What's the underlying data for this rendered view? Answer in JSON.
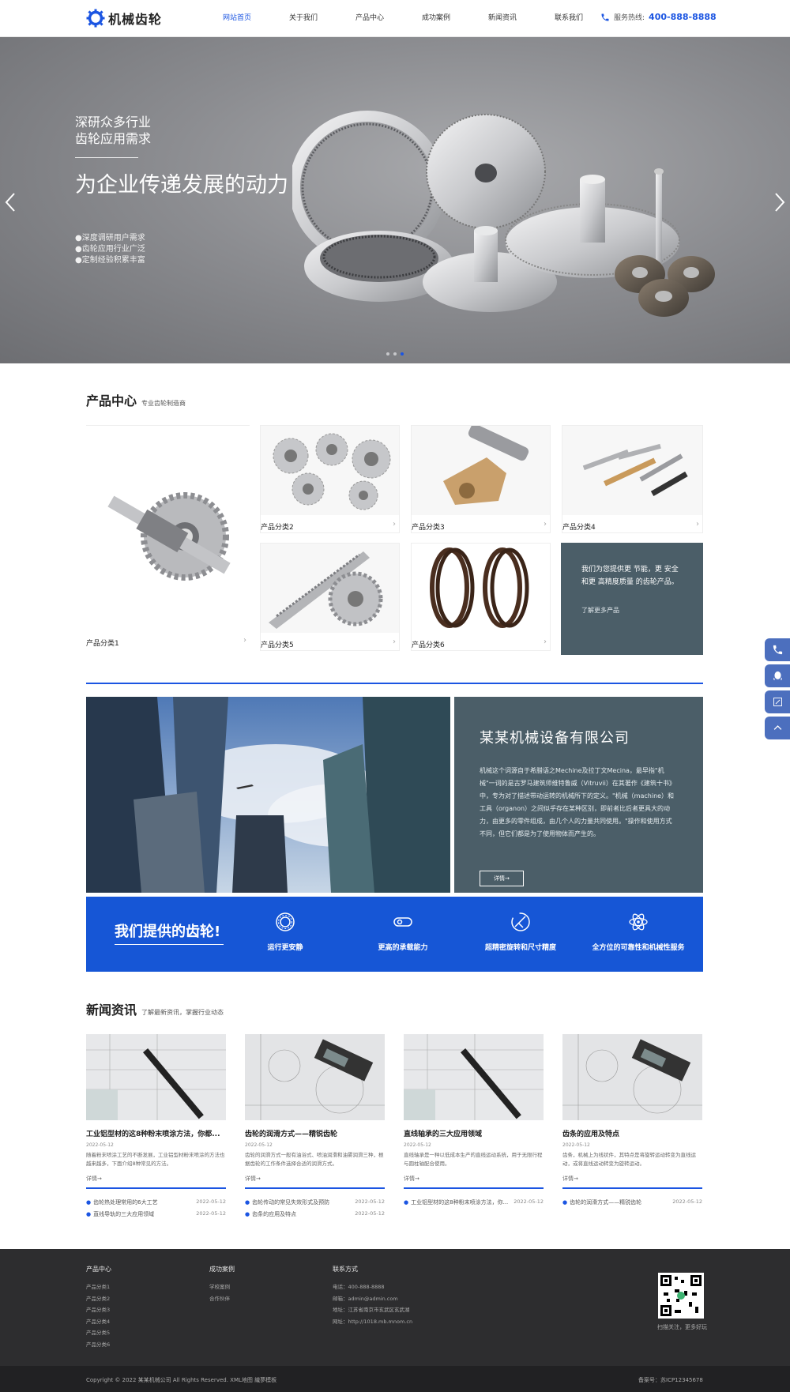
{
  "header": {
    "logo_text": "机械齿轮",
    "nav": [
      {
        "label": "网站首页",
        "active": true
      },
      {
        "label": "关于我们"
      },
      {
        "label": "产品中心"
      },
      {
        "label": "成功案例"
      },
      {
        "label": "新闻资讯"
      },
      {
        "label": "联系我们"
      }
    ],
    "hotline_label": "服务热线:",
    "hotline_number": "400-888-8888",
    "accent_color": "#1b55e2"
  },
  "banner": {
    "subtitle_line1": "深研众多行业",
    "subtitle_line2": "齿轮应用需求",
    "title": "为企业传递发展的动力",
    "bullets": [
      "●深度调研用户需求",
      "●齿轮应用行业广泛",
      "●定制经验积累丰富"
    ],
    "prev_icon": "chevron-left-icon",
    "next_icon": "chevron-right-icon"
  },
  "products": {
    "title": "产品中心",
    "subtitle": "专业齿轮制造商",
    "items": [
      {
        "label": "产品分类1"
      },
      {
        "label": "产品分类2"
      },
      {
        "label": "产品分类3"
      },
      {
        "label": "产品分类4"
      },
      {
        "label": "产品分类5"
      },
      {
        "label": "产品分类6"
      }
    ],
    "promo_text": "我们为您提供更 节能，更 安全和更 高精度质量 的齿轮产品。",
    "promo_link": "了解更多产品"
  },
  "about": {
    "title": "某某机械设备有限公司",
    "text": "机械这个词源自于希腊语之Mechine及拉丁文Mecina，最早指\"机械\"一词的是古罗马建筑师维特鲁威（Vitruvii）在其著作《建筑十书》中，专为对了描述带动运转的机械所下的定义。\"机械（machine）和工具（organon）之间似乎存在某种区别，即前者比后者更具大的动力，由更多的零件组成，由几个人的力量共同使用。\"操作和使用方式不同，但它们都是为了使用物体而产生的。",
    "button": "详情→"
  },
  "features": {
    "title": "我们提供的齿轮!",
    "items": [
      {
        "label": "运行更安静",
        "icon": "bearing-icon"
      },
      {
        "label": "更高的承载能力",
        "icon": "capsule-icon"
      },
      {
        "label": "超精密旋转和尺寸精度",
        "icon": "caliper-icon"
      },
      {
        "label": "全方位的可靠性和机械性服务",
        "icon": "atom-icon"
      }
    ]
  },
  "news": {
    "title": "新闻资讯",
    "subtitle": "了解最新资讯，掌握行业动态",
    "cards": [
      {
        "title": "工业铝型材的这8种粉末喷涂方法，你都...",
        "date": "2022-05-12",
        "summary": "随着粉末喷涂工艺的不断发展，工业铝型材粉末喷涂的方法也越来越多，下面介绍8种常见的方法。",
        "more": "详情→",
        "list": [
          {
            "title": "齿轮热处理常用的6大工艺",
            "date": "2022-05-12"
          },
          {
            "title": "直线导轨的三大应用领域",
            "date": "2022-05-12"
          }
        ]
      },
      {
        "title": "齿轮的润滑方式——精锐齿轮",
        "date": "2022-05-12",
        "summary": "齿轮的润滑方式一般有油浴式、喷油润滑和油雾润滑三种，根据齿轮的工作条件选择合适的润滑方式。",
        "more": "详情→",
        "list": [
          {
            "title": "齿轮传动的常见失效形式及预防",
            "date": "2022-05-12"
          },
          {
            "title": "齿条的应用及特点",
            "date": "2022-05-12"
          }
        ]
      },
      {
        "title": "直线轴承的三大应用领域",
        "date": "2022-05-12",
        "summary": "直线轴承是一种以低成本生产的直线运动系统，用于无限行程与圆柱轴配合使用。",
        "more": "详情→",
        "list": [
          {
            "title": "工业铝型材的这8种粉末喷涂方法，你...",
            "date": "2022-05-12"
          }
        ]
      },
      {
        "title": "齿条的应用及特点",
        "date": "2022-05-12",
        "summary": "齿条，机械上为线状件，其特点是将旋转运动转变为直线运动，或将直线运动转变为旋转运动。",
        "more": "详情→",
        "list": [
          {
            "title": "齿轮的润滑方式——精锐齿轮",
            "date": "2022-05-12"
          }
        ]
      }
    ]
  },
  "footer": {
    "col1_title": "产品中心",
    "col1_items": [
      "产品分类1",
      "产品分类2",
      "产品分类3",
      "产品分类4",
      "产品分类5",
      "产品分类6"
    ],
    "col2_title": "成功案例",
    "col2_items": [
      "学校案例",
      "合作伙伴"
    ],
    "col3_title": "联系方式",
    "col3_items": [
      "电话：400-888-8888",
      "邮箱：admin@admin.com",
      "地址：江苏省南京市玄武区玄武湖",
      "网址：http://1018.mb.mnom.cn"
    ],
    "qr_label": "扫描关注，更多好玩",
    "copyright": "Copyright © 2022 某某机械公司 All Rights Reserved. XML地图 織夢模板",
    "icp": "备案号：苏ICP12345678"
  },
  "float_bar": [
    "phone-icon",
    "qq-icon",
    "edit-icon",
    "back-to-top-icon"
  ]
}
